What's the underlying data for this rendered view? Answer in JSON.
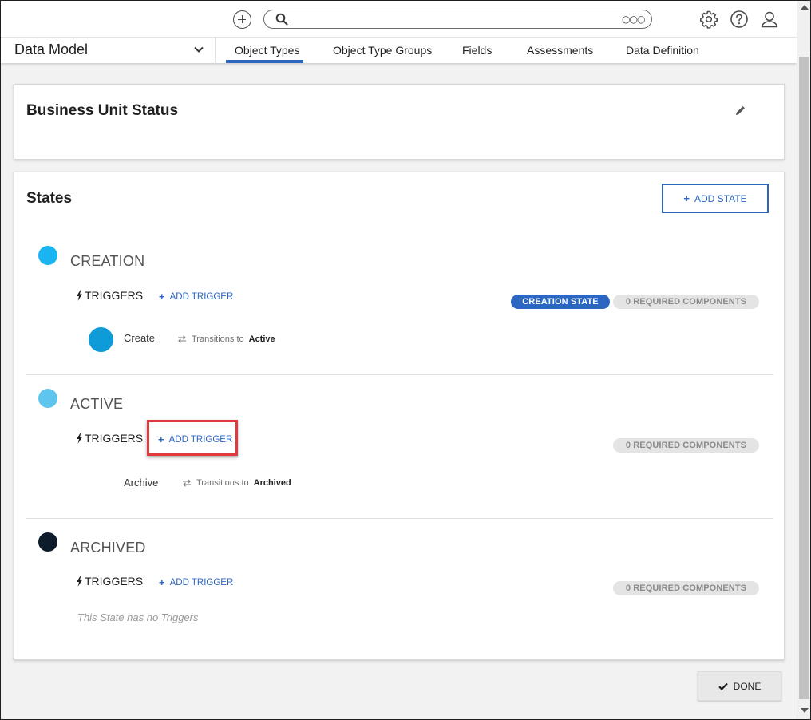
{
  "topbar": {
    "search": {
      "value": "",
      "placeholder": ""
    },
    "icons": [
      "plus-circle-icon",
      "search-icon",
      "more-icon",
      "settings-icon",
      "help-icon",
      "user-icon"
    ]
  },
  "navbar": {
    "title": "Data Model",
    "tabs": [
      {
        "label": "Object Types",
        "active": true
      },
      {
        "label": "Object Type Groups"
      },
      {
        "label": "Fields"
      },
      {
        "label": "Assessments"
      },
      {
        "label": "Data Definition"
      }
    ]
  },
  "object_card": {
    "title": "Business Unit Status"
  },
  "states_card": {
    "title": "States",
    "add_state_label": "ADD STATE",
    "states": [
      {
        "name": "CREATION",
        "color": "#1ab5f0",
        "triggers_label": "TRIGGERS",
        "add_trigger_label": "ADD TRIGGER",
        "creation_badge": "CREATION STATE",
        "required_badge": "0 REQUIRED COMPONENTS",
        "trigger": {
          "name": "Create",
          "transitions_label": "Transitions to",
          "target": "Active",
          "color": "#0f9bd7"
        }
      },
      {
        "name": "ACTIVE",
        "color": "#5ec6ee",
        "triggers_label": "TRIGGERS",
        "add_trigger_label": "ADD TRIGGER",
        "required_badge": "0 REQUIRED COMPONENTS",
        "trigger": {
          "name": "Archive",
          "transitions_label": "Transitions to",
          "target": "Archived"
        }
      },
      {
        "name": "ARCHIVED",
        "color": "#0d1b2a",
        "triggers_label": "TRIGGERS",
        "add_trigger_label": "ADD TRIGGER",
        "required_badge": "0 REQUIRED COMPONENTS",
        "no_triggers_text": "This State has no Triggers"
      }
    ]
  },
  "done_label": "DONE",
  "colors": {
    "accent": "#2b66c2",
    "highlight": "#e0393e"
  }
}
